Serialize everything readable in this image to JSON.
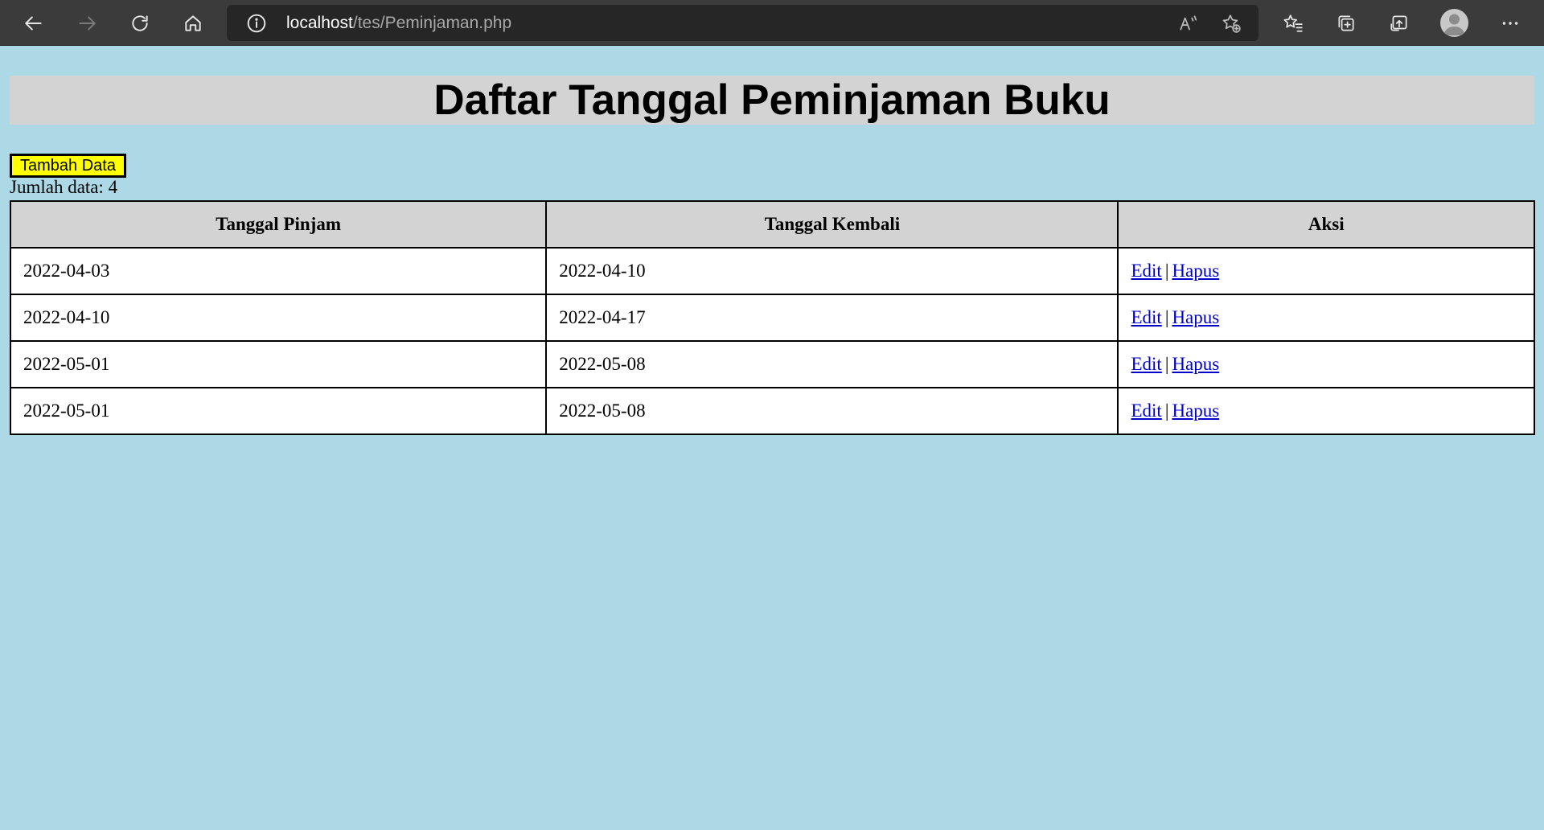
{
  "browser": {
    "url_host": "localhost",
    "url_path": "/tes/Peminjaman.php",
    "icons": [
      "back-icon",
      "forward-icon",
      "reload-icon",
      "home-icon",
      "info-icon",
      "read-aloud-icon",
      "add-favorite-icon",
      "favorites-icon",
      "collections-icon",
      "share-icon",
      "profile-icon",
      "more-icon"
    ]
  },
  "page": {
    "title": "Daftar Tanggal Peminjaman Buku",
    "add_button": "Tambah Data",
    "count_text": "Jumlah data: 4",
    "background": "#add8e6",
    "title_background": "#d3d3d3",
    "button_color": "#ffff00"
  },
  "table": {
    "headers": [
      "Tanggal Pinjam",
      "Tanggal Kembali",
      "Aksi"
    ],
    "rows": [
      {
        "pinjam": "2022-04-03",
        "kembali": "2022-04-10",
        "edit": "Edit",
        "sep": "|",
        "hapus": "Hapus"
      },
      {
        "pinjam": "2022-04-10",
        "kembali": "2022-04-17",
        "edit": "Edit",
        "sep": "|",
        "hapus": "Hapus"
      },
      {
        "pinjam": "2022-05-01",
        "kembali": "2022-05-08",
        "edit": "Edit",
        "sep": "|",
        "hapus": "Hapus"
      },
      {
        "pinjam": "2022-05-01",
        "kembali": "2022-05-08",
        "edit": "Edit",
        "sep": "|",
        "hapus": "Hapus"
      }
    ]
  }
}
